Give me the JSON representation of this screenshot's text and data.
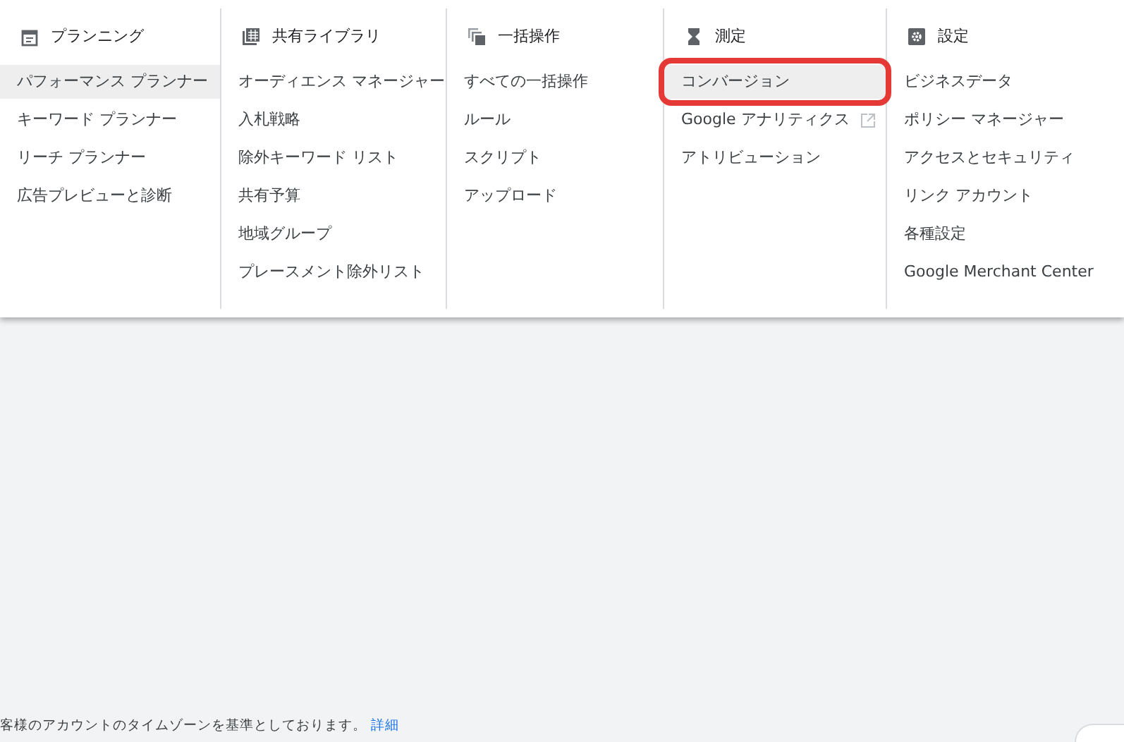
{
  "menu_columns": [
    {
      "title": "プランニング",
      "items": [
        {
          "label": "パフォーマンス プランナー",
          "selected": true,
          "circled": false,
          "external": false
        },
        {
          "label": "キーワード プランナー",
          "selected": false,
          "circled": false,
          "external": false
        },
        {
          "label": "リーチ プランナー",
          "selected": false,
          "circled": false,
          "external": false
        },
        {
          "label": "広告プレビューと診断",
          "selected": false,
          "circled": false,
          "external": false
        }
      ]
    },
    {
      "title": "共有ライブラリ",
      "items": [
        {
          "label": "オーディエンス マネージャー",
          "selected": false,
          "circled": false,
          "external": false
        },
        {
          "label": "入札戦略",
          "selected": false,
          "circled": false,
          "external": false
        },
        {
          "label": "除外キーワード リスト",
          "selected": false,
          "circled": false,
          "external": false
        },
        {
          "label": "共有予算",
          "selected": false,
          "circled": false,
          "external": false
        },
        {
          "label": "地域グループ",
          "selected": false,
          "circled": false,
          "external": false
        },
        {
          "label": "プレースメント除外リスト",
          "selected": false,
          "circled": false,
          "external": false
        }
      ]
    },
    {
      "title": "一括操作",
      "items": [
        {
          "label": "すべての一括操作",
          "selected": false,
          "circled": false,
          "external": false
        },
        {
          "label": "ルール",
          "selected": false,
          "circled": false,
          "external": false
        },
        {
          "label": "スクリプト",
          "selected": false,
          "circled": false,
          "external": false
        },
        {
          "label": "アップロード",
          "selected": false,
          "circled": false,
          "external": false
        }
      ]
    },
    {
      "title": "測定",
      "items": [
        {
          "label": "コンバージョン",
          "selected": true,
          "circled": true,
          "external": false
        },
        {
          "label": "Google アナリティクス",
          "selected": false,
          "circled": false,
          "external": true
        },
        {
          "label": "アトリビューション",
          "selected": false,
          "circled": false,
          "external": false
        }
      ]
    },
    {
      "title": "設定",
      "items": [
        {
          "label": "ビジネスデータ",
          "selected": false,
          "circled": false,
          "external": false
        },
        {
          "label": "ポリシー マネージャー",
          "selected": false,
          "circled": false,
          "external": false
        },
        {
          "label": "アクセスとセキュリティ",
          "selected": false,
          "circled": false,
          "external": false
        },
        {
          "label": "リンク アカウント",
          "selected": false,
          "circled": false,
          "external": false
        },
        {
          "label": "各種設定",
          "selected": false,
          "circled": false,
          "external": false
        },
        {
          "label": "Google Merchant Center",
          "selected": false,
          "circled": false,
          "external": false
        }
      ]
    }
  ],
  "footer": {
    "text": "客様のアカウントのタイムゾーンを基準としております。",
    "link": "詳細"
  }
}
